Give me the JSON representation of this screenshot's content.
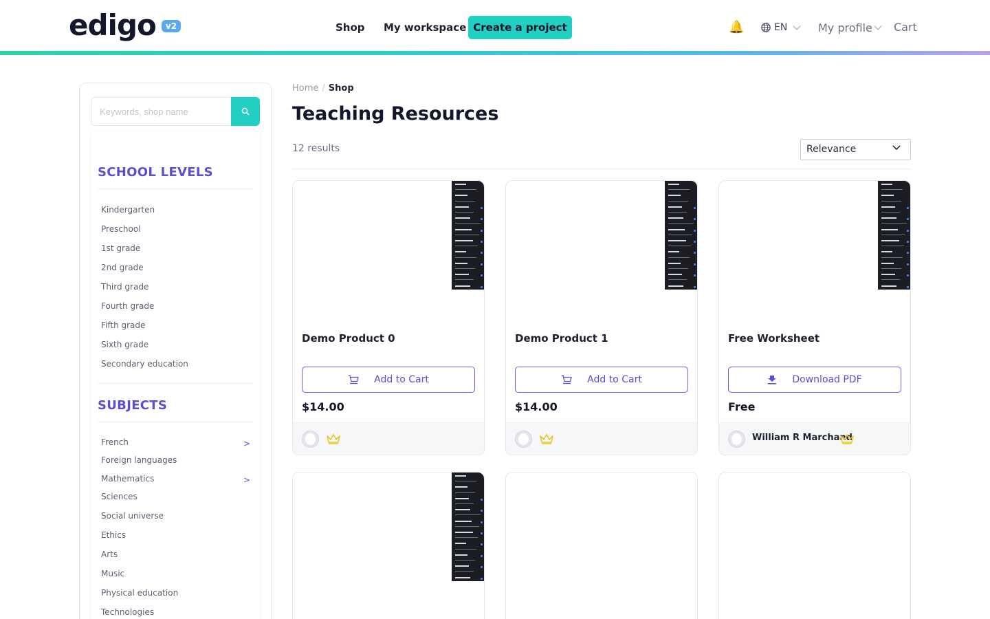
{
  "header": {
    "logo_text": "edigo",
    "logo_badge": "v2",
    "nav": [
      {
        "label": "Shop"
      },
      {
        "label": "My workspace"
      }
    ],
    "cta_label": "Create a project",
    "language": "EN",
    "profile_label": "My profile",
    "cart_label": "Cart",
    "accent_color": "#21cfc3"
  },
  "sidebar": {
    "search_placeholder": "Keywords, shop name",
    "school_levels_title": "SCHOOL LEVELS",
    "school_levels": [
      "Kindergarten",
      "Preschool",
      "1st grade",
      "2nd grade",
      "Third grade",
      "Fourth grade",
      "Fifth grade",
      "Sixth grade",
      "Secondary education"
    ],
    "subjects_title": "SUBJECTS",
    "subjects": [
      {
        "label": "French",
        "expandable": true
      },
      {
        "label": "Foreign languages",
        "expandable": false
      },
      {
        "label": "Mathematics",
        "expandable": true
      },
      {
        "label": "Sciences",
        "expandable": false
      },
      {
        "label": "Social universe",
        "expandable": false
      },
      {
        "label": "Ethics",
        "expandable": false
      },
      {
        "label": "Arts",
        "expandable": false
      },
      {
        "label": "Music",
        "expandable": false
      },
      {
        "label": "Physical education",
        "expandable": false
      },
      {
        "label": "Technologies",
        "expandable": false
      }
    ],
    "expand_glyph": ">",
    "heading_color": "#5a4fd1"
  },
  "main": {
    "breadcrumb": {
      "home": "Home",
      "separator": "/",
      "current": "Shop"
    },
    "title": "Teaching Resources",
    "results": "12 results",
    "sort_value": "Relevance",
    "products": [
      {
        "title": "Demo Product 0",
        "button": "Add to Cart",
        "button_icon": "cart-icon",
        "price": "$14.00",
        "author": "",
        "has_thumbnail": true
      },
      {
        "title": "Demo Product 1",
        "button": "Add to Cart",
        "button_icon": "cart-icon",
        "price": "$14.00",
        "author": "",
        "has_thumbnail": true
      },
      {
        "title": "Free Worksheet",
        "button": "Download PDF",
        "button_icon": "download-icon",
        "price": "Free",
        "author": "William R Marchand",
        "has_thumbnail": true
      },
      {
        "title": "",
        "has_thumbnail": true
      },
      {
        "title": "",
        "has_thumbnail": false
      },
      {
        "title": "",
        "has_thumbnail": false
      }
    ]
  }
}
